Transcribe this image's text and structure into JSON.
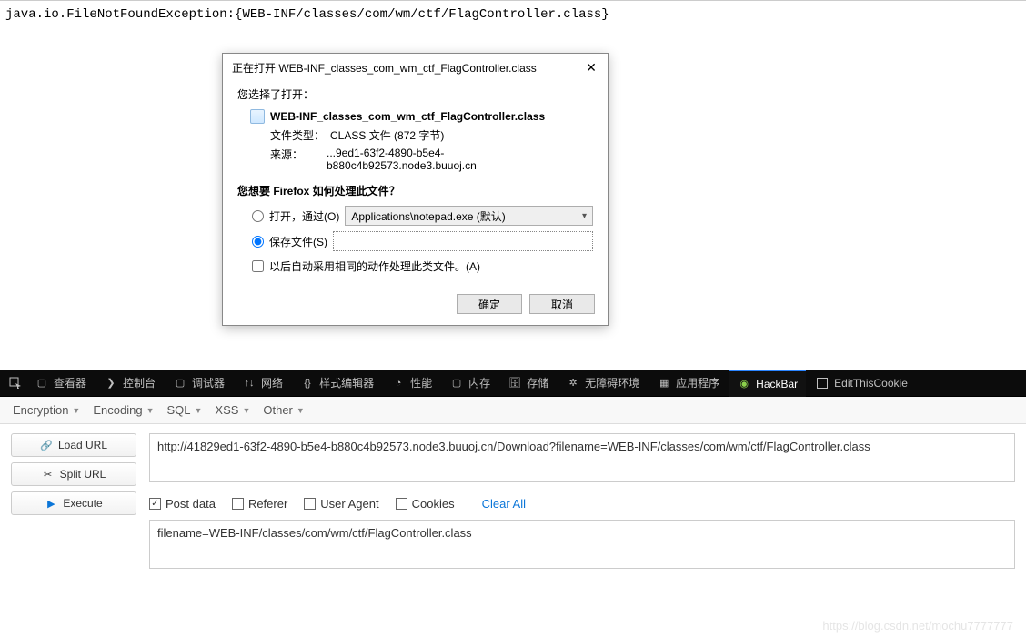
{
  "page": {
    "error_message": "java.io.FileNotFoundException:{WEB-INF/classes/com/wm/ctf/FlagController.class}"
  },
  "dialog": {
    "title": "正在打开 WEB-INF_classes_com_wm_ctf_FlagController.class",
    "q_chosen": "您选择了打开：",
    "filename": "WEB-INF_classes_com_wm_ctf_FlagController.class",
    "filetype_label": "文件类型：",
    "filetype_value": "CLASS 文件 (872 字节)",
    "source_label": "来源：",
    "source_value": "...9ed1-63f2-4890-b5e4-b880c4b92573.node3.buuoj.cn",
    "q_action": "您想要 Firefox 如何处理此文件？",
    "open_with_label": "打开，通过(O)",
    "open_with_app": "Applications\\notepad.exe (默认)",
    "save_label": "保存文件(S)",
    "remember_label": "以后自动采用相同的动作处理此类文件。(A)",
    "ok": "确定",
    "cancel": "取消"
  },
  "devtools_tabs": {
    "inspector": "查看器",
    "console": "控制台",
    "debugger": "调试器",
    "network": "网络",
    "style": "样式编辑器",
    "performance": "性能",
    "memory": "内存",
    "storage": "存储",
    "accessibility": "无障碍环境",
    "apps": "应用程序",
    "hackbar": "HackBar",
    "editcookie": "EditThisCookie"
  },
  "hackbar": {
    "dropdowns": {
      "encryption": "Encryption",
      "encoding": "Encoding",
      "sql": "SQL",
      "xss": "XSS",
      "other": "Other"
    },
    "buttons": {
      "load": "Load URL",
      "split": "Split URL",
      "execute": "Execute"
    },
    "url": "http://41829ed1-63f2-4890-b5e4-b880c4b92573.node3.buuoj.cn/Download?filename=WEB-INF/classes/com/wm/ctf/FlagController.class",
    "options": {
      "post": "Post data",
      "referer": "Referer",
      "useragent": "User Agent",
      "cookies": "Cookies",
      "clear": "Clear All"
    },
    "postdata": "filename=WEB-INF/classes/com/wm/ctf/FlagController.class"
  },
  "watermark": "https://blog.csdn.net/mochu7777777"
}
